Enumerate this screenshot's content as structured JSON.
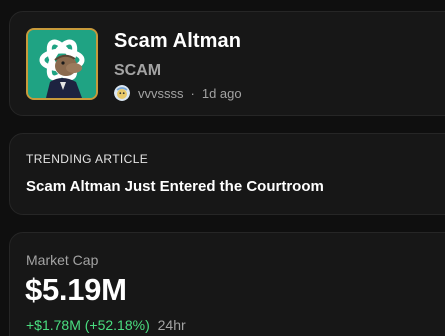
{
  "token": {
    "name": "Scam Altman",
    "ticker": "SCAM",
    "creator": "vvvssss",
    "separator": "·",
    "time_ago": "1d ago",
    "avatar_border_color": "#c79a3b",
    "avatar_bg_color": "#1fa383"
  },
  "trending": {
    "label": "TRENDING ARTICLE",
    "title": "Scam Altman Just Entered the Courtroom"
  },
  "market_cap": {
    "label": "Market Cap",
    "value": "$5.19M",
    "change": "+$1.78M (+52.18%)",
    "period": "24hr",
    "change_color": "#4ade80"
  }
}
